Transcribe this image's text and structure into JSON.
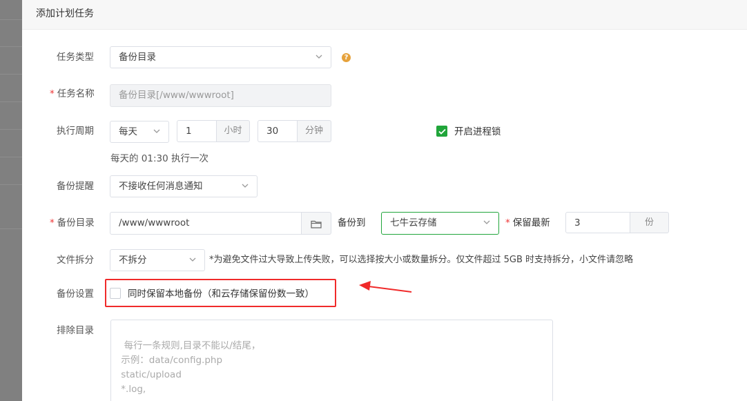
{
  "dialog": {
    "title": "添加计划任务"
  },
  "form": {
    "task_type": {
      "label": "任务类型",
      "value": "备份目录"
    },
    "task_name": {
      "label": "任务名称",
      "placeholder": "备份目录[/www/wwwroot]"
    },
    "period": {
      "label": "执行周期",
      "value": "每天",
      "hour": "1",
      "hour_unit": "小时",
      "minute": "30",
      "minute_unit": "分钟",
      "summary": "每天的 01:30 执行一次"
    },
    "process_lock": {
      "label": "开启进程锁",
      "checked": true
    },
    "notify": {
      "label": "备份提醒",
      "value": "不接收任何消息通知"
    },
    "backup_dir": {
      "label": "备份目录",
      "value": "/www/wwwroot",
      "to_label": "备份到",
      "storage": "七牛云存储",
      "keep_label": "保留最新",
      "keep_value": "3",
      "keep_unit": "份"
    },
    "split": {
      "label": "文件拆分",
      "value": "不拆分",
      "note": "*为避免文件过大导致上传失败，可以选择按大小或数量拆分。仅文件超过 5GB 时支持拆分，小文件请忽略"
    },
    "backup_settings": {
      "label": "备份设置",
      "option": "同时保留本地备份（和云存储保留份数一致）",
      "checked": false
    },
    "exclude": {
      "label": "排除目录",
      "placeholder": "每行一条规则,目录不能以/结尾，\n 示例：data/config.php\n static/upload\n *.log,"
    }
  },
  "colors": {
    "accent": "#20a53a",
    "required": "#ee3333",
    "annotation": "#f02a2a",
    "hint": "#e6a23c"
  },
  "icons": [
    "chevron-down-icon",
    "help-icon",
    "check-icon",
    "folder-icon",
    "arrow-annotation"
  ]
}
